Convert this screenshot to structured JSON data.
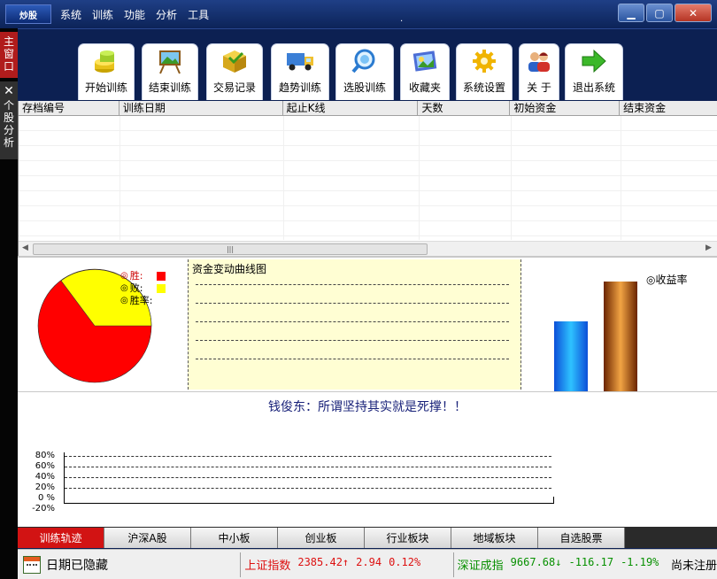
{
  "app": {
    "logo_text": "炒股",
    "menu": [
      "系统",
      "训练",
      "功能",
      "分析",
      "工具"
    ],
    "title_dot": "."
  },
  "sidebar": {
    "main_tab": "主窗口",
    "stock_tab": "个股分析"
  },
  "toolbar": {
    "buttons": [
      {
        "label": "开始训练",
        "icon": "coins-icon"
      },
      {
        "label": "结束训练",
        "icon": "easel-icon"
      },
      {
        "label": "交易记录",
        "icon": "box-icon"
      },
      {
        "label": "趋势训练",
        "icon": "truck-icon"
      },
      {
        "label": "选股训练",
        "icon": "search-icon"
      },
      {
        "label": "收藏夹",
        "icon": "collection-icon"
      },
      {
        "label": "系统设置",
        "icon": "gear-icon"
      },
      {
        "label": "关 于",
        "icon": "people-icon"
      },
      {
        "label": "退出系统",
        "icon": "arrow-right-icon"
      }
    ]
  },
  "table": {
    "columns": [
      "存档编号",
      "训练日期",
      "起止K线",
      "天数",
      "初始资金",
      "结束资金"
    ],
    "rows": [],
    "scroll_grip": "|||"
  },
  "stats": {
    "legend": {
      "win": "胜:",
      "lose": "败:",
      "rate": "胜率:"
    },
    "curve_title": "资金变动曲线图",
    "return_label": "收益率",
    "win_color": "#ff0000",
    "lose_color": "#ffff00"
  },
  "quote": "钱俊东：所谓坚持其实就是死撑！！",
  "yield_chart": {
    "ticks": [
      "80%",
      "60%",
      "40%",
      "20%",
      "0 %",
      "-20%"
    ]
  },
  "bottom_tabs": [
    "训练轨迹",
    "沪深A股",
    "中小板",
    "创业板",
    "行业板块",
    "地域板块",
    "自选股票"
  ],
  "active_tab": "训练轨迹",
  "status": {
    "date_hidden": "日期已隐藏",
    "sh": {
      "name": "上证指数",
      "value": "2385.42",
      "arrow": "↑",
      "change": "2.94",
      "pct": "0.12%"
    },
    "sz": {
      "name": "深证成指",
      "value": "9667.68",
      "arrow": "↓",
      "change": "-116.17",
      "pct": "-1.19%"
    },
    "extra": "尚未注册"
  }
}
